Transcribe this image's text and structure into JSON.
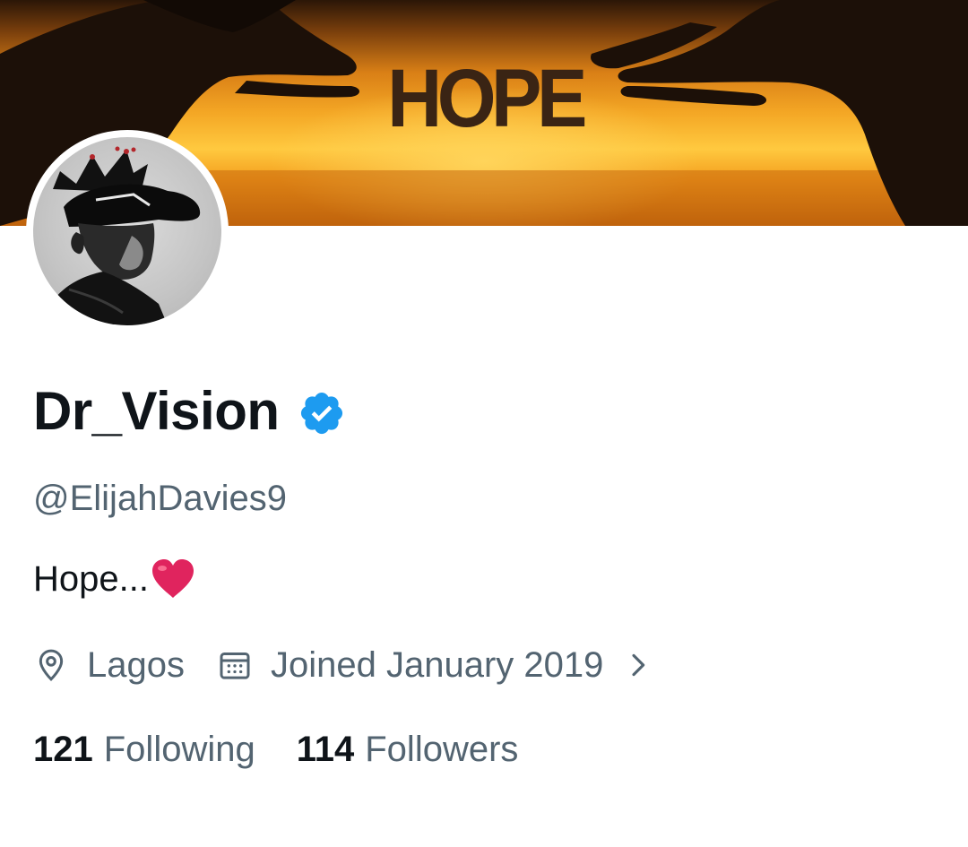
{
  "banner": {
    "word": "HOPE"
  },
  "profile": {
    "display_name": "Dr_Vision",
    "handle": "@ElijahDavies9",
    "bio": "Hope...",
    "location": "Lagos",
    "joined": "Joined January 2019"
  },
  "stats": {
    "following_count": "121",
    "following_label": "Following",
    "followers_count": "114",
    "followers_label": "Followers"
  },
  "icons": {
    "verified": "verified-badge-icon",
    "heart": "red-heart-emoji",
    "location": "location-pin-icon",
    "calendar": "calendar-icon",
    "chevron": "chevron-right-icon"
  },
  "colors": {
    "text_primary": "#0f1419",
    "text_secondary": "#536471",
    "verified_blue": "#1d9bf0",
    "heart_red": "#e0245e"
  }
}
